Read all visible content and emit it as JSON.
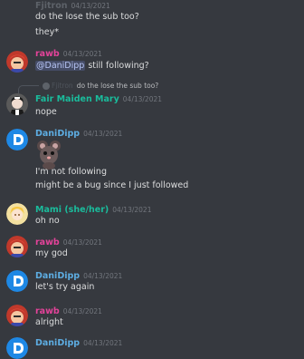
{
  "colors": {
    "background": "#36393f",
    "pink_name": "#e4439a",
    "teal_name": "#1abc9c",
    "blue_name": "#5dade2",
    "timestamp": "#72767d",
    "mention_bg": "#4a5181",
    "dani_avatar": "#1e88e5"
  },
  "messages": [
    {
      "author": "Fjitron",
      "timestamp": "04/13/2021",
      "lines": [
        "do the lose the sub too?",
        "they*"
      ]
    },
    {
      "author": "rawb",
      "timestamp": "04/13/2021",
      "mention": "@DaniDipp",
      "text_after_mention": " still following?",
      "avatar_icon": "red-hair-character-icon"
    },
    {
      "reply_to_text": "do the lose the sub too?",
      "reply_to_author": "Fjitron",
      "author": "Fair Maiden Mary",
      "timestamp": "04/13/2021",
      "lines": [
        "nope"
      ],
      "avatar_icon": "maid-character-icon"
    },
    {
      "author": "DaniDipp",
      "timestamp": "04/13/2021",
      "sticker": "mouse-sticker-icon",
      "lines": [
        "I'm not following",
        "might be a bug since I just followed"
      ],
      "avatar_icon": "d-logo-icon"
    },
    {
      "author": "Mami (she/her)",
      "timestamp": "04/13/2021",
      "lines": [
        "oh no"
      ],
      "avatar_icon": "blonde-character-icon"
    },
    {
      "author": "rawb",
      "timestamp": "04/13/2021",
      "lines": [
        "my god"
      ],
      "avatar_icon": "red-hair-character-icon"
    },
    {
      "author": "DaniDipp",
      "timestamp": "04/13/2021",
      "lines": [
        "let's try again"
      ],
      "avatar_icon": "d-logo-icon"
    },
    {
      "author": "rawb",
      "timestamp": "04/13/2021",
      "lines": [
        "alright"
      ],
      "avatar_icon": "red-hair-character-icon"
    },
    {
      "author": "DaniDipp",
      "timestamp": "04/13/2021",
      "lines": [],
      "avatar_icon": "d-logo-icon"
    }
  ]
}
